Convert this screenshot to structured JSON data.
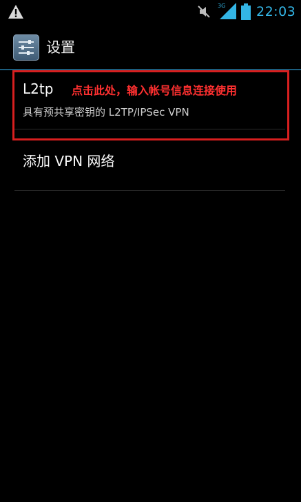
{
  "status_bar": {
    "time": "22:03",
    "network_type": "3G",
    "icons": [
      "warning-icon",
      "mute-icon",
      "signal-icon",
      "battery-icon"
    ],
    "accent_color": "#33b5e5"
  },
  "action_bar": {
    "title": "设置",
    "icon": "settings-icon"
  },
  "vpn_list": [
    {
      "title": "L2tp",
      "subtitle": "具有预共享密钥的 L2TP/IPSec VPN"
    },
    {
      "title": "添加 VPN 网络"
    }
  ],
  "annotation": {
    "text": "点击此处，输入帐号信息连接使用",
    "color": "#d81f1f"
  }
}
